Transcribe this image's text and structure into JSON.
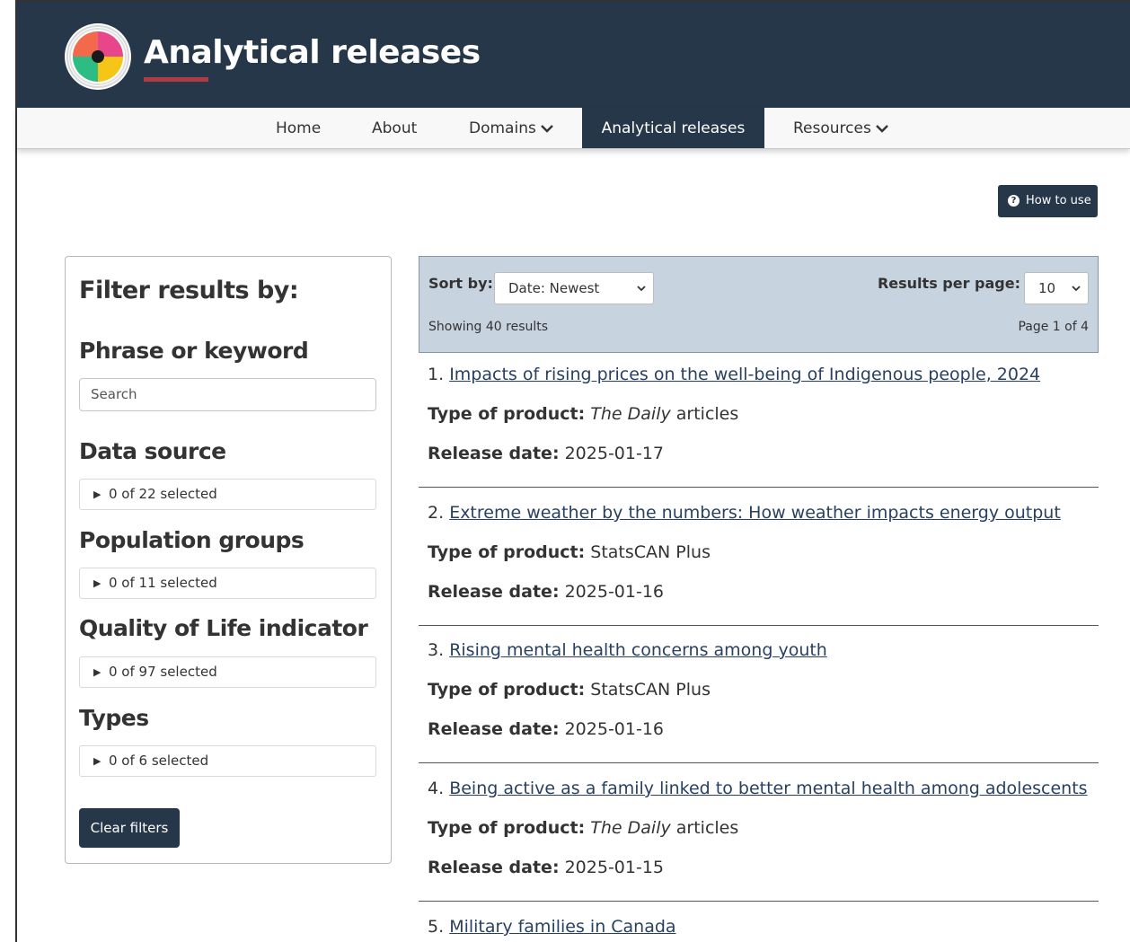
{
  "header": {
    "title": "Analytical releases"
  },
  "nav": {
    "items": [
      {
        "label": "Home"
      },
      {
        "label": "About"
      },
      {
        "label": "Domains",
        "has_dropdown": true
      },
      {
        "label": "Analytical releases",
        "active": true
      },
      {
        "label": "Resources",
        "has_dropdown": true
      }
    ]
  },
  "howto": {
    "label": "How to use",
    "icon": "question-circle-icon"
  },
  "filters": {
    "title": "Filter results by:",
    "phrase_heading": "Phrase or keyword",
    "search_placeholder": "Search",
    "data_source_heading": "Data source",
    "data_source_selected": "0 of 22 selected",
    "population_heading": "Population groups",
    "population_selected": "0 of 11 selected",
    "qol_heading": "Quality of Life indicator",
    "qol_selected": "0 of 97 selected",
    "types_heading": "Types",
    "types_selected": "0 of 6 selected",
    "clear_label": "Clear filters"
  },
  "results_bar": {
    "sort_label": "Sort by:",
    "sort_value": "Date: Newest",
    "per_page_label": "Results per page:",
    "per_page_value": "10",
    "showing": "Showing 40 results",
    "page": "Page 1 of 4"
  },
  "labels": {
    "type": "Type of product:",
    "date": "Release date:"
  },
  "results": [
    {
      "num": "1.",
      "title": "Impacts of rising prices on the well-being of Indigenous people, 2024",
      "type_em": "The Daily",
      "type_rest": " articles",
      "date": "2025-01-17"
    },
    {
      "num": "2.",
      "title": "Extreme weather by the numbers: How weather impacts energy output",
      "type_em": "",
      "type_rest": "StatsCAN Plus",
      "date": "2025-01-16"
    },
    {
      "num": "3.",
      "title": "Rising mental health concerns among youth",
      "type_em": "",
      "type_rest": "StatsCAN Plus",
      "date": "2025-01-16"
    },
    {
      "num": "4.",
      "title": "Being active as a family linked to better mental health among adolescents",
      "type_em": "The Daily",
      "type_rest": " articles",
      "date": "2025-01-15"
    },
    {
      "num": "5.",
      "title": "Military families in Canada"
    }
  ],
  "colors": {
    "brand_dark": "#26374a",
    "accent_red": "#af3c43",
    "link": "#284162",
    "results_bar_bg": "#c8d3e0"
  }
}
